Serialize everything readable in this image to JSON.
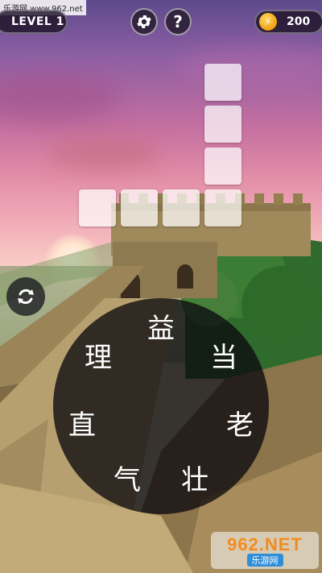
{
  "watermark_top": "乐游网 www.962.net",
  "header": {
    "level_label": "LEVEL 1",
    "coins": "200"
  },
  "icons": {
    "settings": "gear-icon",
    "help": "question-icon",
    "coin": "coin-icon",
    "shuffle": "shuffle-icon"
  },
  "help_label": "?",
  "coin_symbol": "⚡",
  "letters": [
    "益",
    "当",
    "老",
    "壮",
    "气",
    "直",
    "理"
  ],
  "watermark_bottom": {
    "brand": "962.NET",
    "subtitle": "乐游网"
  },
  "colors": {
    "hud_bg": "#1e1428",
    "tile": "#ffffff",
    "coin": "#f0a010",
    "wheel": "#0c0a0e"
  }
}
